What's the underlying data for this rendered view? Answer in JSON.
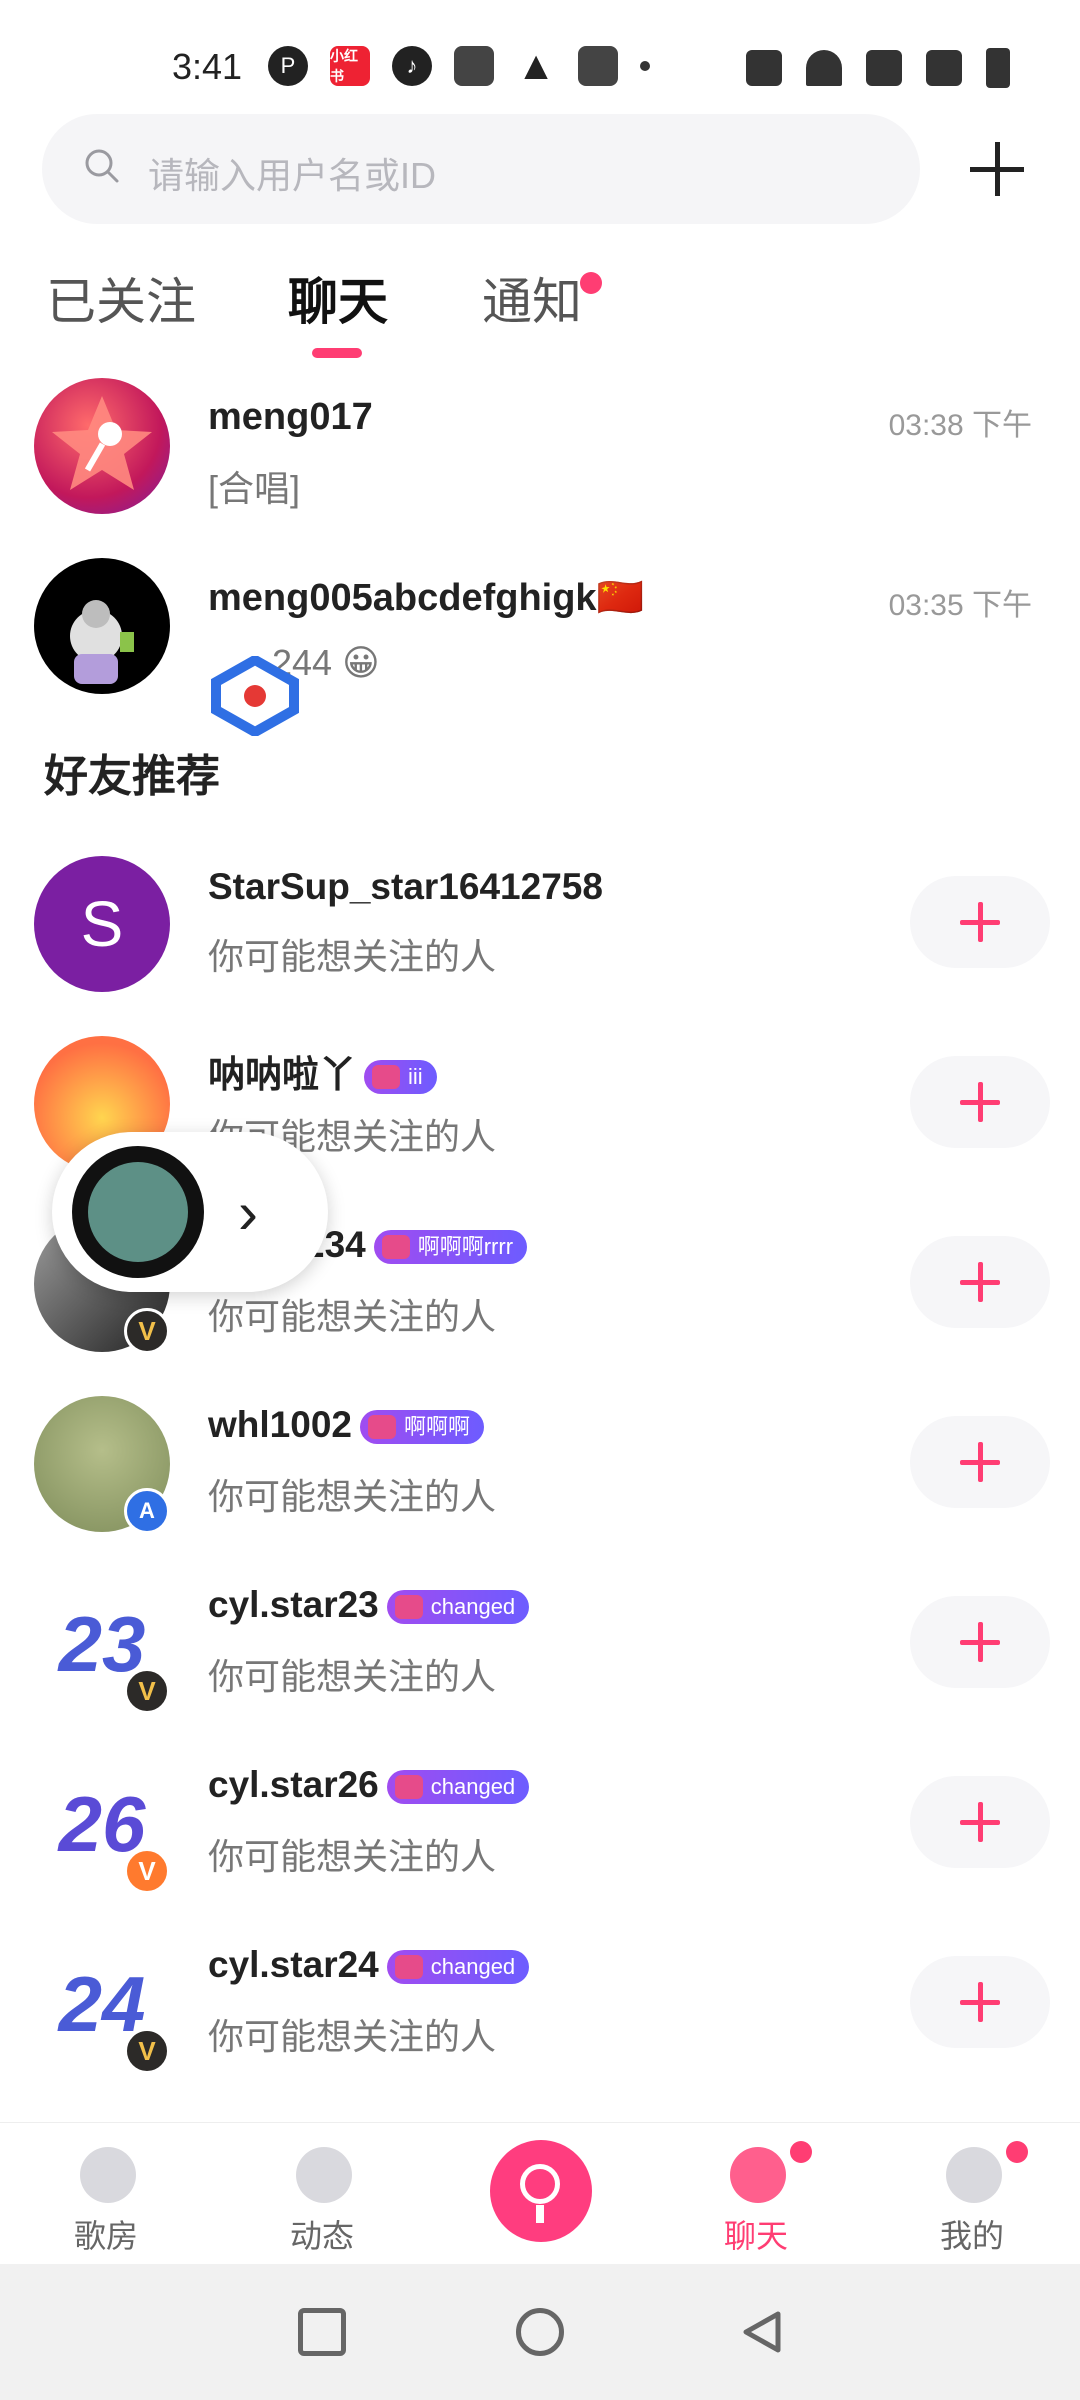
{
  "status_bar": {
    "time": "3:41",
    "left_icons": [
      "p-icon",
      "xiaohongshu-icon",
      "tiktok-icon",
      "wallet-icon",
      "alert-icon",
      "download-icon",
      "dot-icon"
    ],
    "xiaohongshu_label": "小红书",
    "right_icons": [
      "vibrate-icon",
      "wifi-icon",
      "no-signal-icon",
      "no-signal-icon",
      "battery-charging-icon"
    ]
  },
  "search": {
    "placeholder": "请输入用户名或ID"
  },
  "tabs": [
    {
      "label": "已关注",
      "active": false
    },
    {
      "label": "聊天",
      "active": true
    },
    {
      "label": "通知",
      "active": false,
      "has_dot": true
    }
  ],
  "chats": [
    {
      "name": "meng017",
      "time": "03:38 下午",
      "message": "[合唱]"
    },
    {
      "name": "meng005abcdefghigk🇨🇳",
      "time": "03:35 下午",
      "message": "244 😀"
    }
  ],
  "section_title": "好友推荐",
  "recommendations": [
    {
      "name": "StarSup_star16412758",
      "badge": "",
      "subtitle": "你可能想关注的人"
    },
    {
      "name": "呐呐啦丫",
      "badge": "iii",
      "subtitle": "你可能想关注的人"
    },
    {
      "name": "234",
      "badge": "啊啊啊rrrr",
      "subtitle": "你可能想关注的人"
    },
    {
      "name": "whl1002",
      "badge": "啊啊啊",
      "subtitle": "你可能想关注的人"
    },
    {
      "name": "cyl.star23",
      "badge": "changed",
      "subtitle": "你可能想关注的人"
    },
    {
      "name": "cyl.star26",
      "badge": "changed",
      "subtitle": "你可能想关注的人"
    },
    {
      "name": "cyl.star24",
      "badge": "changed",
      "subtitle": "你可能想关注的人"
    }
  ],
  "avatar_texts": {
    "s_letter": "S",
    "n23": "23",
    "n26": "26",
    "n24": "24",
    "v": "V"
  },
  "bottom_nav": [
    {
      "label": "歌房",
      "active": false
    },
    {
      "label": "动态",
      "active": false
    },
    {
      "label": "",
      "active": false
    },
    {
      "label": "聊天",
      "active": true
    },
    {
      "label": "我的",
      "active": false
    }
  ],
  "colors": {
    "accent": "#ff3d73",
    "text": "#222222",
    "muted": "#777777"
  }
}
